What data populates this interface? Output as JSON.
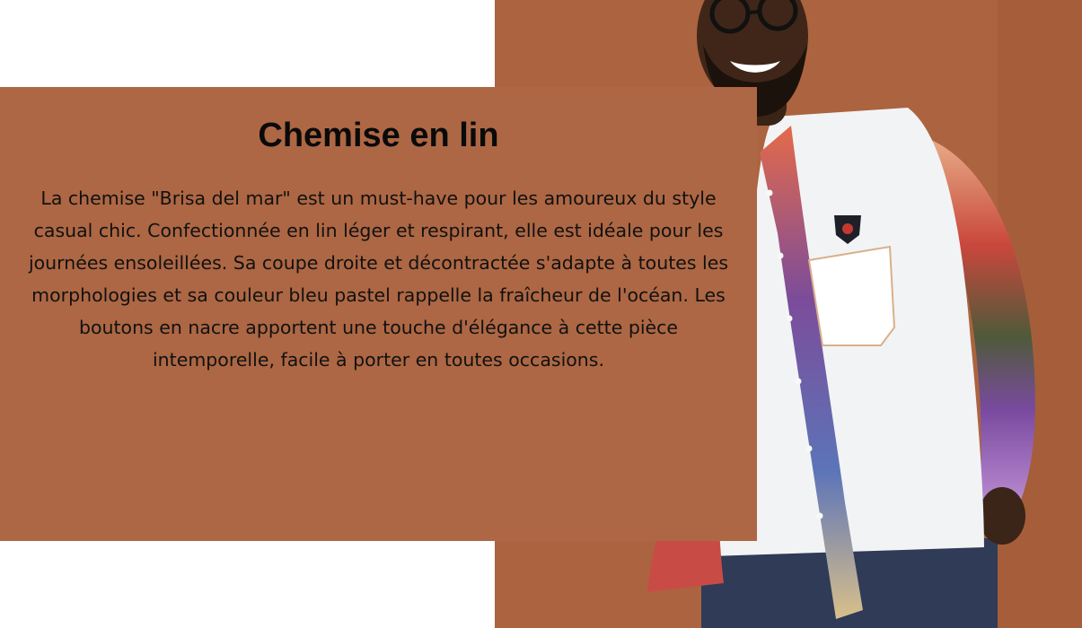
{
  "product": {
    "title": "Chemise en lin",
    "description": "La chemise \"Brisa del mar\" est un must-have pour les amoureux du style casual chic. Confectionnée en lin léger et respirant, elle est idéale pour les journées ensoleillées. Sa coupe droite et décontractée s'adapte à toutes les morphologies et sa couleur bleu pastel rappelle la fraîcheur de l'océan. Les boutons en nacre apportent une touche d'élégance à cette pièce intemporelle, facile à porter en toutes occasions.",
    "image_icon": "model-photo-icon"
  },
  "colors": {
    "card_background": "#ad6744",
    "photo_background": "#aa633f",
    "title_text": "#0a0a0a",
    "body_text": "#111111"
  }
}
